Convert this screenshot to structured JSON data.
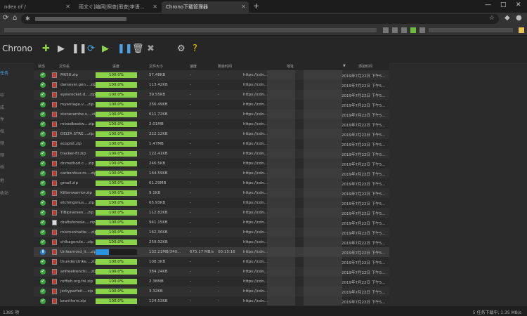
{
  "browser": {
    "tabs": [
      {
        "label": "ndex of /"
      },
      {
        "label": "雨文ぐ]编网|照查|瑕查|李语..."
      },
      {
        "label": "Chrono下载管理器"
      }
    ],
    "new_tab": "+",
    "window_controls": {
      "minimize": "—",
      "maximize": "□",
      "close": "✕"
    }
  },
  "app": {
    "title": "Chrono",
    "toolbar": [
      {
        "name": "add-button",
        "glyph": "✚",
        "color": "#8bd348"
      },
      {
        "name": "start-button",
        "glyph": "▶",
        "color": "#c8c8c8"
      },
      {
        "name": "pause-button",
        "glyph": "❚❚",
        "color": "#c8c8c8"
      },
      {
        "name": "refresh-button",
        "glyph": "⟳",
        "color": "#4aa3e8"
      },
      {
        "name": "start-all-button",
        "glyph": "▶",
        "color": "#8bd348"
      },
      {
        "name": "pause-all-button",
        "glyph": "❚❚",
        "color": "#4aa3e8"
      },
      {
        "name": "delete-button",
        "glyph": "🗑",
        "color": "#c8c8c8"
      },
      {
        "name": "clear-button",
        "glyph": "✖",
        "color": "#9a9a9a"
      },
      {
        "name": "settings-button",
        "glyph": "⚙",
        "color": "#c8c8c8"
      },
      {
        "name": "help-button",
        "glyph": "?",
        "color": "#f1c40f"
      }
    ]
  },
  "sidebar": {
    "items": [
      {
        "label": "任务",
        "active": true
      },
      {
        "label": "中"
      },
      {
        "label": "成"
      },
      {
        "label": "件"
      },
      {
        "label": "档"
      },
      {
        "label": "频"
      },
      {
        "label": "频"
      },
      {
        "label": "档"
      },
      {
        "label": "他"
      },
      {
        "label": "收站"
      }
    ]
  },
  "table": {
    "headers": {
      "status": "状态",
      "filename": "文件名",
      "progress": "进度",
      "size": "文件大小",
      "speed": "速度",
      "remaining": "剩余时间",
      "url": "地址",
      "date": "添加时间"
    },
    "rows": [
      {
        "icon": "check",
        "ftype": "zip",
        "name": "M658.zip",
        "progress": 100,
        "ptext": "100.0%",
        "size": "57.48KB",
        "speed": "-",
        "remain": "-",
        "url": "https://cdn...",
        "date": "2019年7月22日 下午5..."
      },
      {
        "icon": "check",
        "ftype": "zip",
        "name": "darseyer.gen....zip",
        "progress": 100,
        "ptext": "100.0%",
        "size": "113.42KB",
        "speed": "-",
        "remain": "-",
        "url": "https://cdn...",
        "date": "2019年7月22日 下午5..."
      },
      {
        "icon": "check",
        "ftype": "zip",
        "name": "eyesrocket.d....zip",
        "progress": 100,
        "ptext": "100.0%",
        "size": "39.55KB",
        "speed": "-",
        "remain": "-",
        "url": "https://cdn...",
        "date": "2019年7月22日 下午5..."
      },
      {
        "icon": "check",
        "ftype": "zip",
        "name": "myantage.v....zip",
        "progress": 100,
        "ptext": "100.0%",
        "size": "256.49KB",
        "speed": "-",
        "remain": "-",
        "url": "https://cdn...",
        "date": "2019年7月22日 下午5..."
      },
      {
        "icon": "check",
        "ftype": "zip",
        "name": "stoneramhe.s....zip",
        "progress": 100,
        "ptext": "100.0%",
        "size": "611.72KB",
        "speed": "-",
        "remain": "-",
        "url": "https://cdn...",
        "date": "2019年7月22日 下午5..."
      },
      {
        "icon": "check",
        "ftype": "zip",
        "name": "mixedbeatw....zip",
        "progress": 100,
        "ptext": "100.0%",
        "size": "2.01MB",
        "speed": "-",
        "remain": "-",
        "url": "https://cdn...",
        "date": "2019年7月22日 下午5..."
      },
      {
        "icon": "check",
        "ftype": "zip",
        "name": "DELTA STRE....zip",
        "progress": 100,
        "ptext": "100.0%",
        "size": "222.12KB",
        "speed": "-",
        "remain": "-",
        "url": "https://cdn...",
        "date": "2019年7月22日 下午5..."
      },
      {
        "icon": "check",
        "ftype": "zip",
        "name": "ecoplot.zip",
        "progress": 100,
        "ptext": "100.0%",
        "size": "1.47MB",
        "speed": "-",
        "remain": "-",
        "url": "https://cdn...",
        "date": "2019年7月22日 下午5..."
      },
      {
        "icon": "check",
        "ftype": "zip",
        "name": "tracker-fir.zip",
        "progress": 100,
        "ptext": "100.0%",
        "size": "122.41KB",
        "speed": "-",
        "remain": "-",
        "url": "https://cdn...",
        "date": "2019年7月22日 下午5..."
      },
      {
        "icon": "check",
        "ftype": "zip",
        "name": "dr.method.c....zip",
        "progress": 100,
        "ptext": "100.0%",
        "size": "246.5KB",
        "speed": "-",
        "remain": "-",
        "url": "https://cdn...",
        "date": "2019年7月22日 下午5..."
      },
      {
        "icon": "check",
        "ftype": "zip",
        "name": "carbonfour.m....zip",
        "progress": 100,
        "ptext": "100.0%",
        "size": "144.59KB",
        "speed": "-",
        "remain": "-",
        "url": "https://cdn...",
        "date": "2019年7月22日 下午5..."
      },
      {
        "icon": "check",
        "ftype": "zip",
        "name": "gmail.zip",
        "progress": 100,
        "ptext": "100.0%",
        "size": "61.29MB",
        "speed": "-",
        "remain": "-",
        "url": "https://cdn...",
        "date": "2019年7月22日 下午5..."
      },
      {
        "icon": "check",
        "ftype": "zip",
        "name": "Kittenwarrior.zip",
        "progress": 100,
        "ptext": "100.0%",
        "size": "9.1KB",
        "speed": "-",
        "remain": "-",
        "url": "https://cdn...",
        "date": "2019年7月22日 下午5..."
      },
      {
        "icon": "check",
        "ftype": "zip",
        "name": "etchingsnus....zip",
        "progress": 100,
        "ptext": "100.0%",
        "size": "65.93KB",
        "speed": "-",
        "remain": "-",
        "url": "https://cdn...",
        "date": "2019年7月22日 下午5..."
      },
      {
        "icon": "check",
        "ftype": "zip",
        "name": "TiBlpnarsen....zip",
        "progress": 100,
        "ptext": "100.0%",
        "size": "112.82KB",
        "speed": "-",
        "remain": "-",
        "url": "https://cdn...",
        "date": "2019年7月22日 下午5..."
      },
      {
        "icon": "check",
        "ftype": "plain",
        "name": "draftsforsole....zip",
        "progress": 100,
        "ptext": "100.0%",
        "size": "941.15KB",
        "speed": "-",
        "remain": "-",
        "url": "https://cdn...",
        "date": "2019年7月22日 下午5..."
      },
      {
        "icon": "check",
        "ftype": "zip",
        "name": "mixmenhatte....zip",
        "progress": 100,
        "ptext": "100.0%",
        "size": "162.36KB",
        "speed": "-",
        "remain": "-",
        "url": "https://cdn...",
        "date": "2019年7月22日 下午5..."
      },
      {
        "icon": "check",
        "ftype": "zip",
        "name": "chikagorule....zip",
        "progress": 100,
        "ptext": "100.0%",
        "size": "259.92KB",
        "speed": "-",
        "remain": "-",
        "url": "https://cdn...",
        "date": "2019年7月22日 下午5..."
      },
      {
        "icon": "downloading",
        "ftype": "zip",
        "name": "Unlearnord_ii....zip",
        "progress": 32,
        "ptext": "32.9%",
        "size": "132.21MB/340...",
        "speed": "675.17 MB/s",
        "remain": "00:15:16",
        "url": "https://cdn...",
        "date": "2019年7月22日 下午5..."
      },
      {
        "icon": "check",
        "ftype": "zip",
        "name": "thunderstrike....zip",
        "progress": 100,
        "ptext": "100.0%",
        "size": "108.3KB",
        "speed": "-",
        "remain": "-",
        "url": "https://cdn...",
        "date": "2019年7月22日 下午5..."
      },
      {
        "icon": "check",
        "ftype": "zip",
        "name": "anfreetrenchi....zip",
        "progress": 100,
        "ptext": "100.0%",
        "size": "384.24KB",
        "speed": "-",
        "remain": "-",
        "url": "https://cdn...",
        "date": "2019年7月22日 下午5..."
      },
      {
        "icon": "check",
        "ftype": "zip",
        "name": "roffish.org.fol.zip",
        "progress": 100,
        "ptext": "100.0%",
        "size": "2.38MB",
        "speed": "-",
        "remain": "-",
        "url": "https://cdn...",
        "date": "2019年7月22日 下午5..."
      },
      {
        "icon": "check",
        "ftype": "zip",
        "name": "jerkyparfeit....zip",
        "progress": 100,
        "ptext": "100.0%",
        "size": "3.32KB",
        "speed": "-",
        "remain": "-",
        "url": "https://cdn...",
        "date": "2019年7月22日 下午5..."
      },
      {
        "icon": "check",
        "ftype": "zip",
        "name": "bronthers.zip",
        "progress": 100,
        "ptext": "100.0%",
        "size": "124.53KB",
        "speed": "-",
        "remain": "-",
        "url": "https://cdn...",
        "date": "2019年7月22日 下午5..."
      }
    ]
  },
  "statusbar": {
    "left": "1385 项",
    "right": "5 任务下载中, 1.35 MB/s"
  }
}
